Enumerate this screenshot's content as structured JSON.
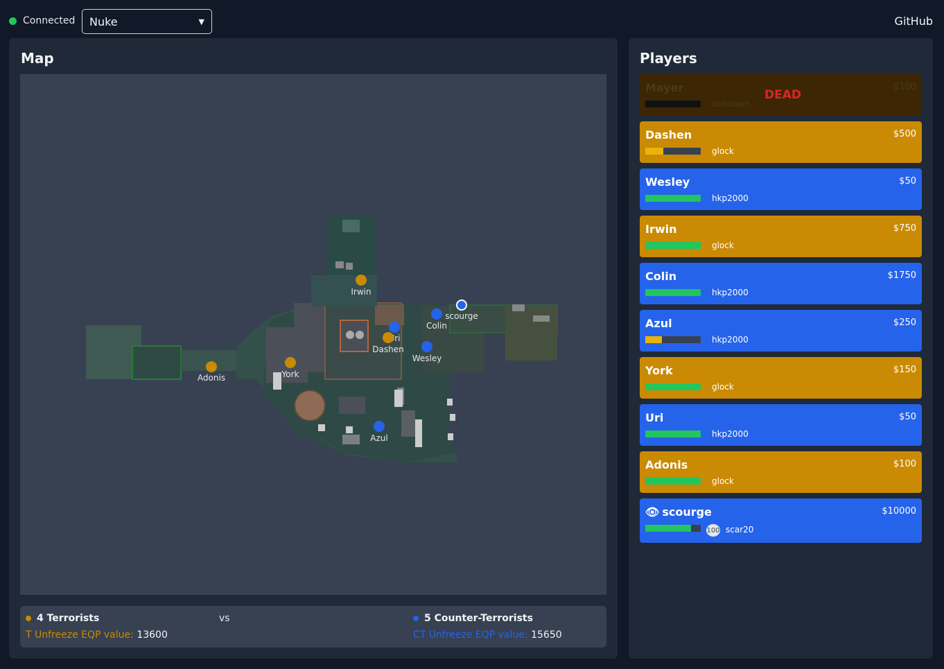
{
  "header": {
    "status": "Connected",
    "selected_map": "Nuke",
    "github": "GitHub"
  },
  "map_panel": {
    "title": "Map",
    "markers": [
      {
        "name": "Irwin",
        "team": "T",
        "self": false
      },
      {
        "name": "Colin",
        "team": "CT",
        "self": false
      },
      {
        "name": "scourge",
        "team": "CT",
        "self": true
      },
      {
        "name": "Uri",
        "team": "CT",
        "self": false
      },
      {
        "name": "Dashen",
        "team": "T",
        "self": false
      },
      {
        "name": "Wesley",
        "team": "CT",
        "self": false
      },
      {
        "name": "York",
        "team": "T",
        "self": false
      },
      {
        "name": "Adonis",
        "team": "T",
        "self": false
      },
      {
        "name": "Azul",
        "team": "CT",
        "self": false
      }
    ]
  },
  "scoreboard": {
    "t_label": "4 Terrorists",
    "vs": "vs",
    "ct_label": "5 Counter-Terrorists",
    "t_eqp_label": "T Unfreeze EQP value:",
    "t_eqp_value": "13600",
    "ct_eqp_label": "CT Unfreeze EQP value:",
    "ct_eqp_value": "15650"
  },
  "players_panel": {
    "title": "Players",
    "dead_label": "DEAD",
    "players": [
      {
        "name": "Mayer",
        "money": "$100",
        "weapon": "unknown",
        "team": "T",
        "hp": 0,
        "dead": true
      },
      {
        "name": "Dashen",
        "money": "$500",
        "weapon": "glock",
        "team": "T",
        "hp": 32
      },
      {
        "name": "Wesley",
        "money": "$50",
        "weapon": "hkp2000",
        "team": "CT",
        "hp": 100
      },
      {
        "name": "Irwin",
        "money": "$750",
        "weapon": "glock",
        "team": "T",
        "hp": 100
      },
      {
        "name": "Colin",
        "money": "$1750",
        "weapon": "hkp2000",
        "team": "CT",
        "hp": 100
      },
      {
        "name": "Azul",
        "money": "$250",
        "weapon": "hkp2000",
        "team": "CT",
        "hp": 30
      },
      {
        "name": "York",
        "money": "$150",
        "weapon": "glock",
        "team": "T",
        "hp": 100
      },
      {
        "name": "Uri",
        "money": "$50",
        "weapon": "hkp2000",
        "team": "CT",
        "hp": 100
      },
      {
        "name": "Adonis",
        "money": "$100",
        "weapon": "glock",
        "team": "T",
        "hp": 100
      },
      {
        "name": "scourge",
        "money": "$10000",
        "weapon": "scar20",
        "team": "CT",
        "hp": 82,
        "armor": "100",
        "self": true
      }
    ]
  },
  "colors": {
    "t": "#ca8a04",
    "ct": "#2563eb",
    "hp_high": "#22c55e",
    "hp_low": "#eab308",
    "dead_text": "#dc2626"
  }
}
